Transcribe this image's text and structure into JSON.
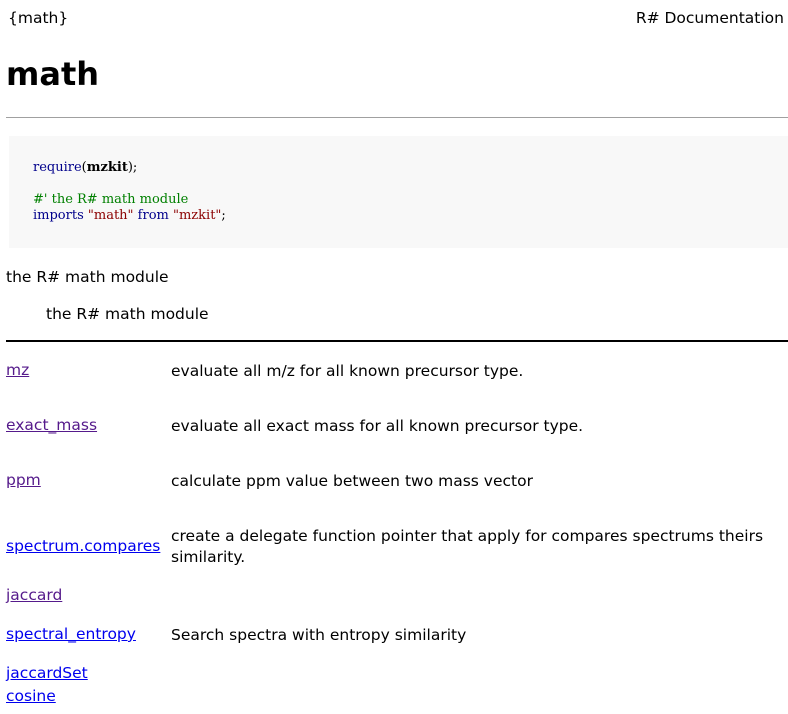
{
  "header": {
    "package_tag": "{math}",
    "doc_label": "R# Documentation"
  },
  "page_title": "math",
  "code": {
    "line1_fn": "require",
    "line1_arg": "mzkit",
    "line1_tail": ");",
    "comment": "#' the R# math module",
    "imports_kw": "imports",
    "imports_str1": "\"math\"",
    "from_kw": "from",
    "imports_str2": "\"mzkit\"",
    "imports_tail": ";"
  },
  "description": {
    "summary": "the R# math module",
    "detail": "the R# math module"
  },
  "functions": [
    {
      "name": "mz",
      "description": "evaluate all m/z for all known precursor type."
    },
    {
      "name": "exact_mass",
      "description": "evaluate all exact mass for all known precursor type."
    },
    {
      "name": "ppm",
      "description": "calculate ppm value between two mass vector"
    },
    {
      "name": "spectrum.compares",
      "description": "create a delegate function pointer that apply for compares spectrums theirs similarity."
    },
    {
      "name": "jaccard",
      "description": ""
    },
    {
      "name": "spectral_entropy",
      "description": "Search spectra with entropy similarity"
    },
    {
      "name": "jaccardSet",
      "description": ""
    },
    {
      "name": "cosine",
      "description": ""
    }
  ]
}
